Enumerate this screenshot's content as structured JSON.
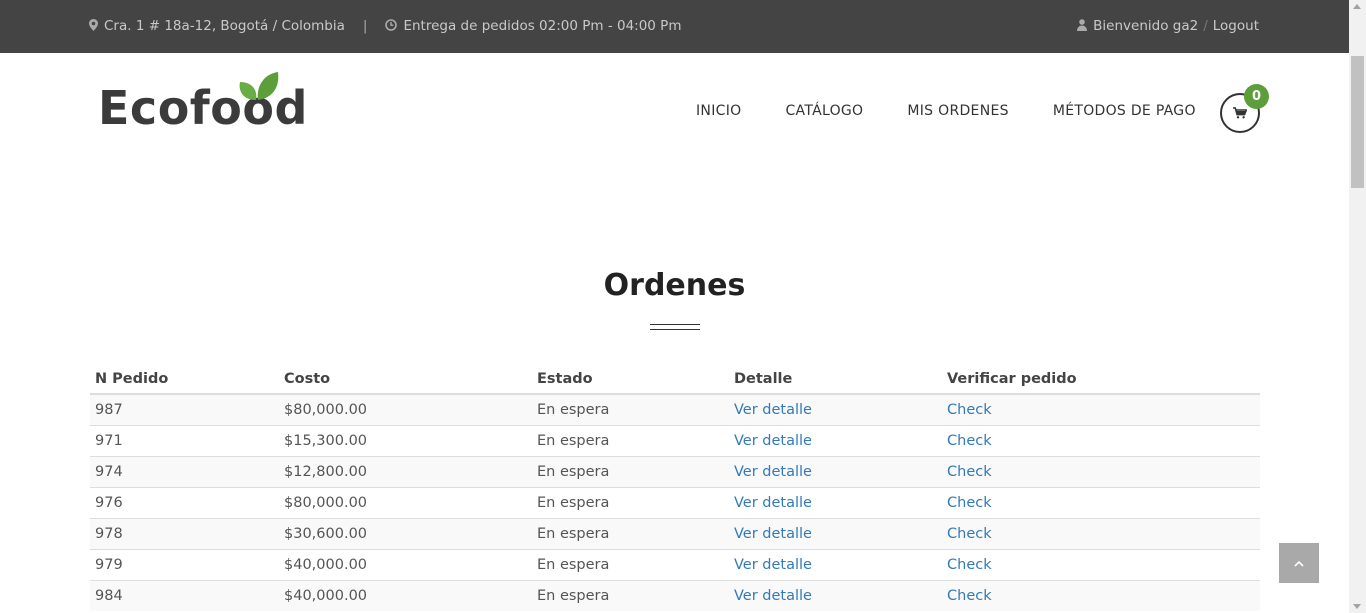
{
  "topbar": {
    "address": "Cra. 1 # 18a-12, Bogotá / Colombia",
    "separator": "|",
    "delivery": "Entrega de pedidos 02:00 Pm - 04:00 Pm",
    "welcome": "Bienvenido ga2",
    "slash": "/",
    "logout": "Logout",
    "icons": {
      "address": "map-marker-icon",
      "delivery": "clock-icon",
      "user": "user-icon"
    }
  },
  "brand": {
    "name": "Ecofood",
    "leaf_color": "#5c9e3a"
  },
  "nav": {
    "items": [
      {
        "label": "INICIO"
      },
      {
        "label": "CATÁLOGO"
      },
      {
        "label": "MIS ORDENES"
      },
      {
        "label": "MÉTODOS DE PAGO"
      }
    ],
    "cart": {
      "icon": "shopping-cart-icon",
      "count": "0",
      "badge_color": "#5c9e3a"
    }
  },
  "main": {
    "title": "Ordenes",
    "table": {
      "headers": [
        "N Pedido",
        "Costo",
        "Estado",
        "Detalle",
        "Verificar pedido"
      ],
      "rows": [
        {
          "id": "987",
          "cost": "$80,000.00",
          "status": "En espera",
          "detail": "Ver detalle",
          "verify": "Check"
        },
        {
          "id": "971",
          "cost": "$15,300.00",
          "status": "En espera",
          "detail": "Ver detalle",
          "verify": "Check"
        },
        {
          "id": "974",
          "cost": "$12,800.00",
          "status": "En espera",
          "detail": "Ver detalle",
          "verify": "Check"
        },
        {
          "id": "976",
          "cost": "$80,000.00",
          "status": "En espera",
          "detail": "Ver detalle",
          "verify": "Check"
        },
        {
          "id": "978",
          "cost": "$30,600.00",
          "status": "En espera",
          "detail": "Ver detalle",
          "verify": "Check"
        },
        {
          "id": "979",
          "cost": "$40,000.00",
          "status": "En espera",
          "detail": "Ver detalle",
          "verify": "Check"
        },
        {
          "id": "984",
          "cost": "$40,000.00",
          "status": "En espera",
          "detail": "Ver detalle",
          "verify": "Check"
        }
      ]
    }
  },
  "scroll_to_top": {
    "icon": "chevron-up-icon"
  },
  "colors": {
    "topbar_bg": "#444444",
    "accent_green": "#5c9e3a",
    "link": "#337ab7"
  }
}
